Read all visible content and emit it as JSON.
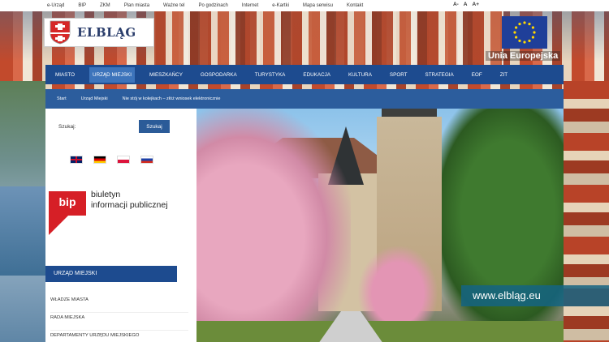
{
  "topbar": {
    "links": [
      "e-Urząd",
      "BIP",
      "ZKM",
      "Plan miasta",
      "Ważne tel",
      "Po godzinach",
      "Internet",
      "e-Kartki",
      "Mapa serwisu",
      "Kontakt"
    ],
    "font_sizes": [
      "A-",
      "A",
      "A+"
    ]
  },
  "logo": {
    "text": "ELBLĄG"
  },
  "eu": {
    "label": "Unia Europejska",
    "flag_color": "#1f3f99"
  },
  "mainnav": {
    "items": [
      "MIASTO",
      "URZĄD MIEJSKI",
      "MIESZKAŃCY",
      "GOSPODARKA",
      "TURYSTYKA",
      "EDUKACJA",
      "KULTURA",
      "SPORT",
      "STRATEGIA",
      "EOF",
      "ZIT"
    ],
    "active_index": 1
  },
  "breadcrumb": {
    "items": [
      "Start",
      "Urząd Miejski",
      "Nie stój w kolejkach – złóż wniosek elektronicznie"
    ]
  },
  "search": {
    "label": "Szukaj:",
    "placeholder": "",
    "button": "Szukaj"
  },
  "languages": [
    "english",
    "deutsch",
    "polski",
    "russian"
  ],
  "bip": {
    "mark": "bip",
    "text_line1": "biuletyn",
    "text_line2": "informacji publicznej"
  },
  "sidebar": {
    "section_title": "URZĄD MIEJSKI",
    "links": [
      "WŁADZE MIASTA",
      "RADA MIEJSKA",
      "DEPARTAMENTY URZĘDU MIEJSKIEGO"
    ]
  },
  "hero": {
    "url_caption": "www.elbląg.eu"
  },
  "colors": {
    "nav": "#1d4b8f",
    "nav_active": "#3d74bb",
    "crumbs": "#2c5d9d",
    "caption": "#14647f"
  }
}
